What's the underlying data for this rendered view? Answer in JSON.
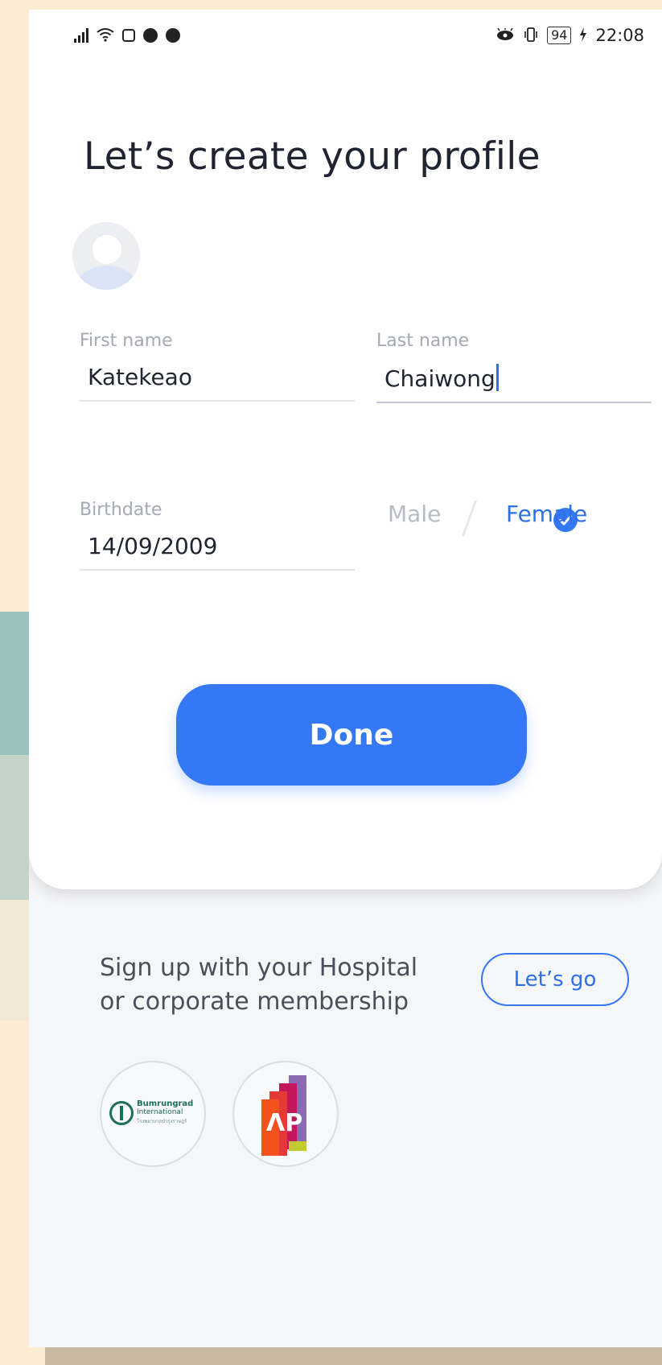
{
  "status_bar": {
    "time": "22:08",
    "battery": "94",
    "left_icons": [
      "signal-icon",
      "wifi-icon",
      "instagram-icon",
      "line-icon",
      "messenger-icon"
    ],
    "right_icons": [
      "eye-comfort-icon",
      "vibrate-icon",
      "battery-icon",
      "charging-icon"
    ]
  },
  "page": {
    "title": "Let’s create your profile"
  },
  "form": {
    "first_name": {
      "label": "First name",
      "value": "Katekeao"
    },
    "last_name": {
      "label": "Last name",
      "value": "Chaiwong"
    },
    "birthdate": {
      "label": "Birthdate",
      "value": "14/09/2009"
    },
    "gender": {
      "male": "Male",
      "female": "Female",
      "selected": "Female"
    },
    "done_label": "Done"
  },
  "membership": {
    "text_line1": "Sign up with your Hospital",
    "text_line2": "or corporate membership",
    "button_label": "Let’s go",
    "partners": {
      "bumrungrad": {
        "name": "Bumrungrad",
        "sub": "International",
        "thai": "โรงพยาบาลบำรุงราษฎร์"
      },
      "ap": {
        "mark": "ΛP"
      }
    }
  },
  "colors": {
    "accent": "#3478f6",
    "title": "#1f2430",
    "muted": "#a4a9b3"
  }
}
